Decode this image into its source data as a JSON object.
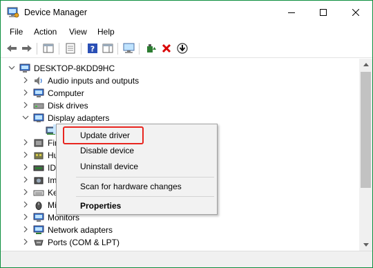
{
  "window": {
    "title": "Device Manager",
    "accent": "#0b8e3d"
  },
  "menu": {
    "items": [
      "File",
      "Action",
      "View",
      "Help"
    ]
  },
  "toolbar": {
    "icons": [
      "back-arrow-icon",
      "forward-arrow-icon",
      "show-hide-tree-icon",
      "properties-icon",
      "help-icon",
      "action-pane-icon",
      "scan-hardware-icon",
      "update-driver-icon",
      "uninstall-icon",
      "download-icon"
    ],
    "uninstall_color": "#d90000"
  },
  "tree": {
    "root": "DESKTOP-8KDD9HC",
    "items": [
      {
        "label": "Audio inputs and outputs",
        "icon": "speaker-icon"
      },
      {
        "label": "Computer",
        "icon": "computer-icon"
      },
      {
        "label": "Disk drives",
        "icon": "disk-drive-icon"
      },
      {
        "label": "Display adapters",
        "icon": "display-adapter-icon",
        "expanded": true
      },
      {
        "label": "",
        "icon": "display-adapter-icon",
        "child": true
      },
      {
        "label": "Fir",
        "icon": "firmware-icon"
      },
      {
        "label": "Hu",
        "icon": "hid-icon"
      },
      {
        "label": "ID",
        "icon": "ide-icon"
      },
      {
        "label": "Im",
        "icon": "imaging-icon"
      },
      {
        "label": "Ke",
        "icon": "keyboard-icon"
      },
      {
        "label": "Mi",
        "icon": "mouse-icon"
      },
      {
        "label": "Monitors",
        "icon": "monitor-icon"
      },
      {
        "label": "Network adapters",
        "icon": "network-adapter-icon"
      },
      {
        "label": "Ports (COM & LPT)",
        "icon": "port-icon"
      }
    ]
  },
  "context_menu": {
    "update_driver": "Update driver",
    "disable_device": "Disable device",
    "uninstall_device": "Uninstall device",
    "scan": "Scan for hardware changes",
    "properties": "Properties",
    "highlight_color": "#e8251f"
  }
}
